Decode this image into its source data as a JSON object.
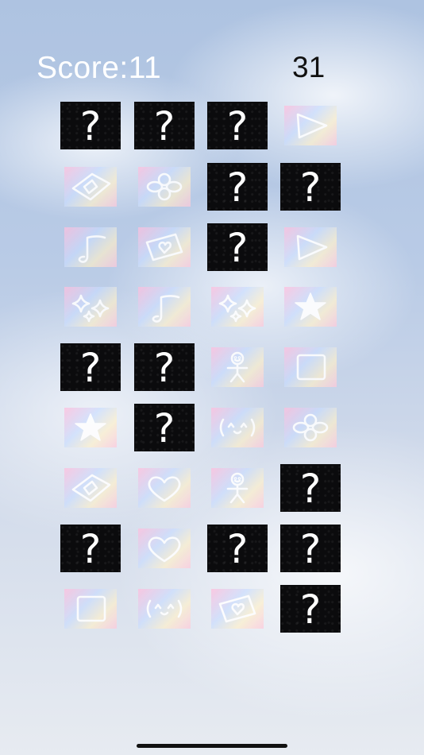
{
  "score_text": "Score:11",
  "timer_text": "31",
  "colors": {
    "score": "#ffffff",
    "timer": "#111111",
    "card_back": "#0b0b0d"
  },
  "hidden_glyph": "?",
  "rows": [
    [
      "hidden",
      "hidden",
      "hidden",
      "play-icon"
    ],
    [
      "diamond-icon",
      "flower-icon",
      "hidden",
      "hidden"
    ],
    [
      "music-note-icon",
      "heart-tilted-icon",
      "hidden",
      "play-icon"
    ],
    [
      "sparkle-icon",
      "music-note-icon",
      "sparkle-icon",
      "star-icon"
    ],
    [
      "hidden",
      "hidden",
      "stick-figure-icon",
      "square-icon"
    ],
    [
      "star-icon",
      "hidden",
      "smile-face-icon",
      "flower-icon"
    ],
    [
      "diamond-icon",
      "heart-icon",
      "stick-figure-icon",
      "hidden"
    ],
    [
      "hidden",
      "heart-icon",
      "hidden",
      "hidden"
    ],
    [
      "square-icon",
      "smile-face-icon",
      "heart-tilted-icon",
      "hidden"
    ]
  ]
}
